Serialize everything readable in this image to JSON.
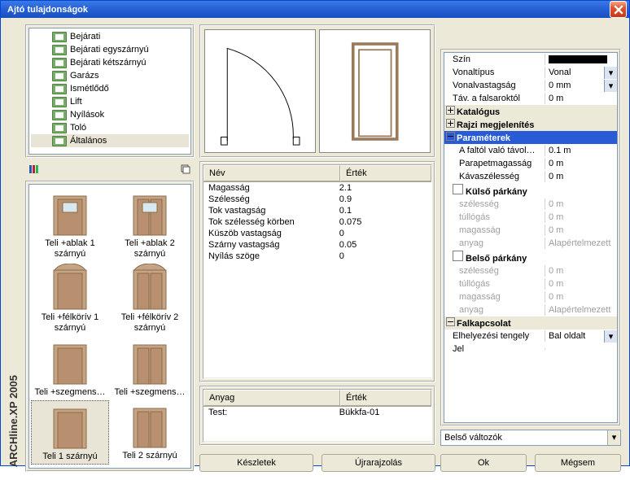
{
  "title": "Ajtó tulajdonságok",
  "sidelabel": "ARCHline.XP 2005",
  "tree": [
    {
      "label": "Bejárati"
    },
    {
      "label": "Bejárati egyszárnyú"
    },
    {
      "label": "Bejárati kétszárnyú"
    },
    {
      "label": "Garázs"
    },
    {
      "label": "Ismétlődő"
    },
    {
      "label": "Lift"
    },
    {
      "label": "Nyílások"
    },
    {
      "label": "Toló"
    },
    {
      "label": "Általános"
    }
  ],
  "thumbs": [
    {
      "label": "Teli +ablak 1 szárnyú"
    },
    {
      "label": "Teli +ablak 2 szárnyú"
    },
    {
      "label": "Teli +félkörív 1 szárnyú"
    },
    {
      "label": "Teli +félkörív 2 szárnyú"
    },
    {
      "label": "Teli +szegmens…"
    },
    {
      "label": "Teli +szegmens…"
    },
    {
      "label": "Teli 1 szárnyú"
    },
    {
      "label": "Teli 2 szárnyú"
    }
  ],
  "selected_thumb": 6,
  "paramgrid": {
    "head_name": "Név",
    "head_value": "Érték",
    "rows": [
      {
        "k": "Magasság",
        "v": "2.1"
      },
      {
        "k": "Szélesség",
        "v": "0.9"
      },
      {
        "k": "Tok vastagság",
        "v": "0.1"
      },
      {
        "k": "Tok szélesség körben",
        "v": "0.075"
      },
      {
        "k": "Küszöb vastagság",
        "v": "0"
      },
      {
        "k": "Szárny vastagság",
        "v": "0.05"
      },
      {
        "k": "Nyílás szöge",
        "v": "0"
      }
    ]
  },
  "matgrid": {
    "head_name": "Anyag",
    "head_value": "Érték",
    "rows": [
      {
        "k": "Test:",
        "v": "Bükkfa-01"
      }
    ]
  },
  "buttons": {
    "keszletek": "Készletek",
    "ujrarajz": "Újrarajzolás",
    "ok": "Ok",
    "megsem": "Mégsem"
  },
  "combo": {
    "label": "Belső változók"
  },
  "props": [
    {
      "type": "row",
      "k": "Szín",
      "v": "__swatch__"
    },
    {
      "type": "row",
      "k": "Vonaltípus",
      "v": "Vonal",
      "dd": true
    },
    {
      "type": "row",
      "k": "Vonalvastagság",
      "v": "0 mm",
      "dd": true
    },
    {
      "type": "row",
      "k": "Táv. a falsaroktól",
      "v": "0 m"
    },
    {
      "type": "group",
      "label": "Katalógus",
      "open": false
    },
    {
      "type": "group",
      "label": "Rajzi megjelenítés",
      "open": false
    },
    {
      "type": "group",
      "label": "Paraméterek",
      "open": true,
      "selected": true
    },
    {
      "type": "row",
      "k": "A faltól való távol…",
      "v": "0.1 m",
      "indent": true
    },
    {
      "type": "row",
      "k": "Parapetmagasság",
      "v": "0 m",
      "indent": true
    },
    {
      "type": "row",
      "k": "Kávaszélesség",
      "v": "0 m",
      "indent": true
    },
    {
      "type": "check",
      "label": "Külső párkány"
    },
    {
      "type": "row",
      "k": "szélesség",
      "v": "0 m",
      "dim": true,
      "indent": true
    },
    {
      "type": "row",
      "k": "túllógás",
      "v": "0 m",
      "dim": true,
      "indent": true
    },
    {
      "type": "row",
      "k": "magasság",
      "v": "0 m",
      "dim": true,
      "indent": true
    },
    {
      "type": "row",
      "k": "anyag",
      "v": "Alapértelmezett",
      "dim": true,
      "indent": true
    },
    {
      "type": "check",
      "label": "Belső párkány"
    },
    {
      "type": "row",
      "k": "szélesség",
      "v": "0 m",
      "dim": true,
      "indent": true
    },
    {
      "type": "row",
      "k": "túllógás",
      "v": "0 m",
      "dim": true,
      "indent": true
    },
    {
      "type": "row",
      "k": "magasság",
      "v": "0 m",
      "dim": true,
      "indent": true
    },
    {
      "type": "row",
      "k": "anyag",
      "v": "Alapértelmezett",
      "dim": true,
      "indent": true
    },
    {
      "type": "group",
      "label": "Falkapcsolat",
      "open": true
    },
    {
      "type": "row",
      "k": "Elhelyezési tengely",
      "v": "Bal oldalt",
      "dd": true
    },
    {
      "type": "row",
      "k": "Jel",
      "v": ""
    }
  ]
}
